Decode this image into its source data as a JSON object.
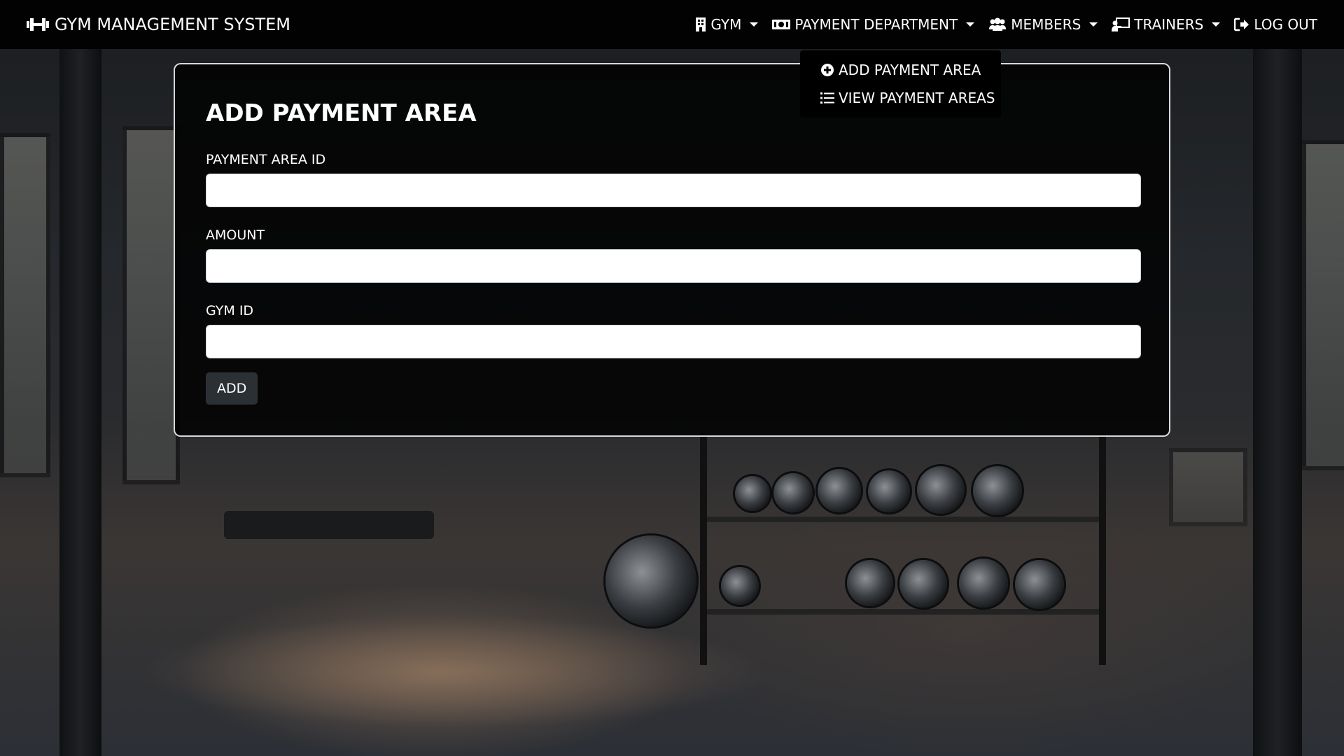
{
  "brand": {
    "title": "GYM MANAGEMENT SYSTEM",
    "icon": "dumbbell-icon"
  },
  "nav": {
    "items": [
      {
        "label": "GYM",
        "icon": "building-icon",
        "has_dropdown": true
      },
      {
        "label": "PAYMENT DEPARTMENT",
        "icon": "money-bill-icon",
        "has_dropdown": true,
        "expanded": true
      },
      {
        "label": "MEMBERS",
        "icon": "users-icon",
        "has_dropdown": true
      },
      {
        "label": "TRAINERS",
        "icon": "chalkboard-teacher-icon",
        "has_dropdown": true
      },
      {
        "label": "LOG OUT",
        "icon": "sign-out-icon",
        "has_dropdown": false
      }
    ]
  },
  "dropdown": {
    "items": [
      {
        "label": "ADD PAYMENT AREA",
        "icon": "plus-circle-icon"
      },
      {
        "label": "VIEW PAYMENT AREAS",
        "icon": "list-icon"
      }
    ]
  },
  "form": {
    "title": "ADD PAYMENT AREA",
    "fields": [
      {
        "label": "PAYMENT AREA ID",
        "value": "",
        "placeholder": ""
      },
      {
        "label": "AMOUNT",
        "value": "",
        "placeholder": ""
      },
      {
        "label": "GYM ID",
        "value": "",
        "placeholder": ""
      }
    ],
    "submit_label": "ADD"
  },
  "colors": {
    "navbar_bg": "#000000",
    "card_bg": "#000000",
    "card_border": "#d9d9d9",
    "button_bg": "#2b3035",
    "text": "#ffffff"
  }
}
